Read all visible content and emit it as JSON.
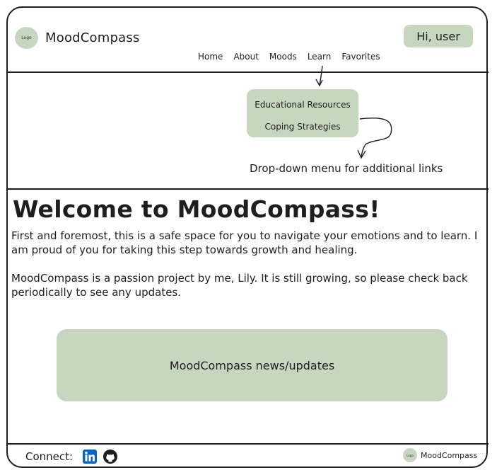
{
  "header": {
    "logo_text": "Logo",
    "brand": "MoodCompass",
    "greeting": "Hi, user",
    "nav": [
      "Home",
      "About",
      "Moods",
      "Learn",
      "Favorites"
    ]
  },
  "dropdown": {
    "items": [
      "Educational Resources",
      "Coping Strategies"
    ],
    "annotation": "Drop-down menu for additional links"
  },
  "main": {
    "title": "Welcome to MoodCompass!",
    "paragraph1": "First and foremost, this is a safe space for you to navigate your emotions and to learn. I am proud of you for taking this step towards growth and healing.",
    "paragraph2": "MoodCompass is a passion project by me, Lily. It is still growing, so please check back periodically to see any updates.",
    "news_label": "MoodCompass news/updates"
  },
  "footer": {
    "connect_label": "Connect:",
    "social": [
      "linkedin-icon",
      "github-icon"
    ],
    "logo_text": "Logo",
    "brand": "MoodCompass"
  },
  "colors": {
    "accent": "#c7d7bf",
    "ink": "#1e1e1e",
    "linkedin": "#0a66c2"
  }
}
